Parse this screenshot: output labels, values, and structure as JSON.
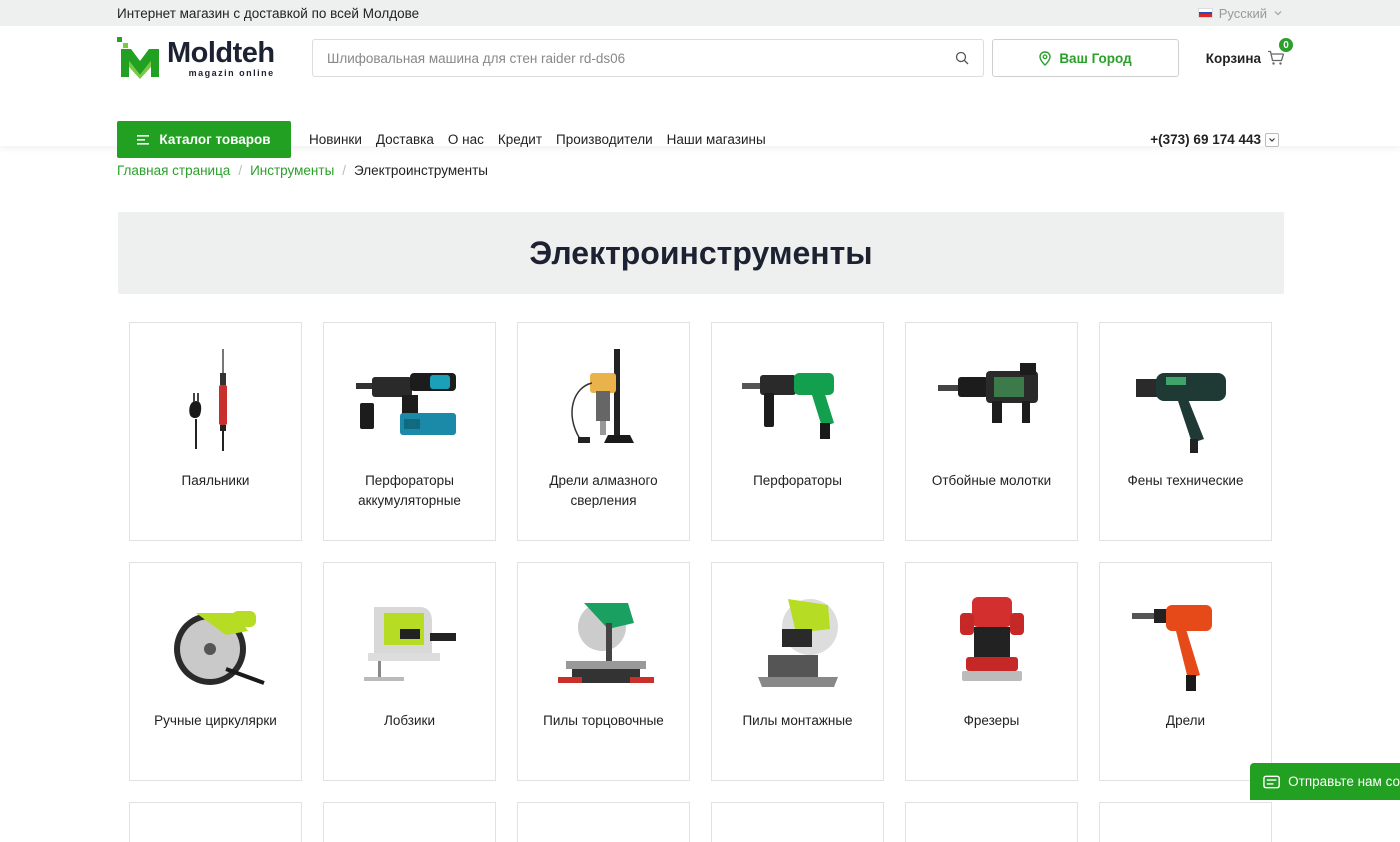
{
  "topbar": {
    "tagline": "Интернет магазин с доставкой по всей Молдове",
    "language": "Русский"
  },
  "logo": {
    "name": "Moldteh",
    "sub": "magazin online"
  },
  "search": {
    "placeholder": "Шлифовальная машина для стен raider rd-ds06"
  },
  "city_button": "Ваш Город",
  "cart": {
    "label": "Корзина",
    "count": "0"
  },
  "catalog_button": "Каталог товаров",
  "nav": [
    "Новинки",
    "Доставка",
    "О нас",
    "Кредит",
    "Производители",
    "Наши магазины"
  ],
  "phone": "+(373) 69 174 443",
  "breadcrumb": {
    "home": "Главная страница",
    "parent": "Инструменты",
    "current": "Электроинструменты"
  },
  "page_title": "Электроинструменты",
  "categories": [
    {
      "label": "Паяльники",
      "icon": "soldering-iron-icon"
    },
    {
      "label": "Перфораторы аккумуляторные",
      "icon": "cordless-rotary-hammer-icon"
    },
    {
      "label": "Дрели алмазного сверления",
      "icon": "diamond-drill-icon"
    },
    {
      "label": "Перфораторы",
      "icon": "rotary-hammer-icon"
    },
    {
      "label": "Отбойные молотки",
      "icon": "demolition-hammer-icon"
    },
    {
      "label": "Фены технические",
      "icon": "heat-gun-icon"
    },
    {
      "label": "Ручные циркулярки",
      "icon": "circular-saw-icon"
    },
    {
      "label": "Лобзики",
      "icon": "jigsaw-icon"
    },
    {
      "label": "Пилы торцовочные",
      "icon": "miter-saw-icon"
    },
    {
      "label": "Пилы монтажные",
      "icon": "cut-off-saw-icon"
    },
    {
      "label": "Фрезеры",
      "icon": "router-icon"
    },
    {
      "label": "Дрели",
      "icon": "drill-icon"
    }
  ],
  "chat_button": "Отправьте нам со",
  "colors": {
    "accent": "#21a021",
    "banner": "#eef0ef",
    "text": "#1d2233"
  }
}
